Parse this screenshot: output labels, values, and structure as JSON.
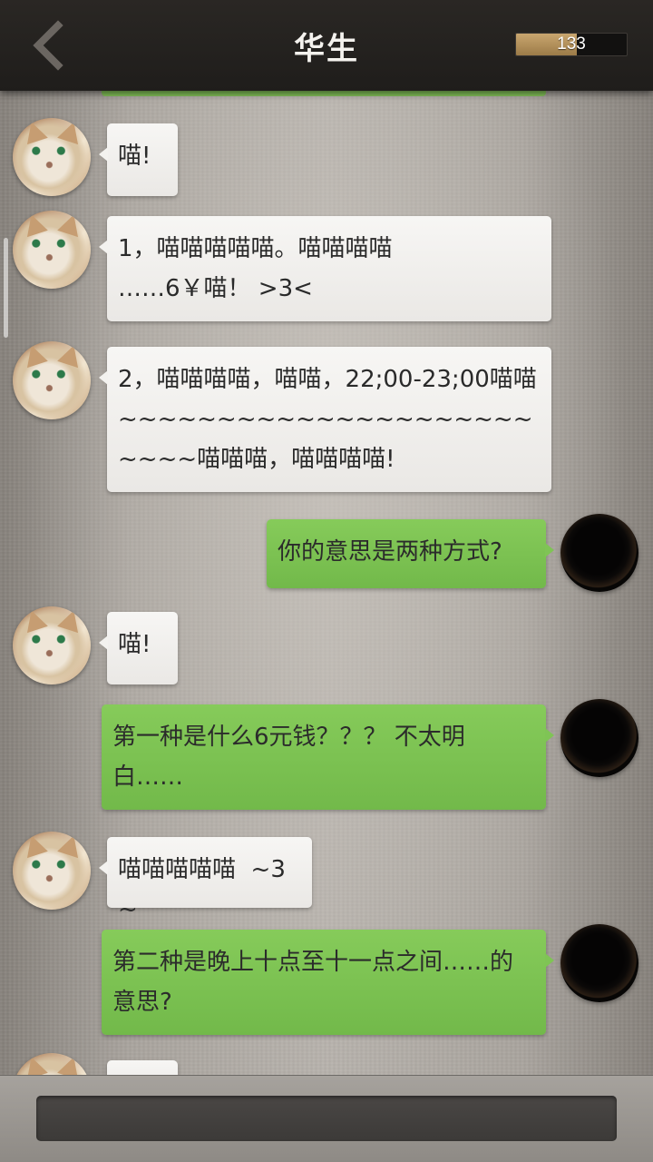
{
  "header": {
    "title": "华生",
    "back_icon": "chevron-left-icon",
    "counter_value": "133",
    "counter_fill_fraction": 0.55
  },
  "messages": [
    {
      "side": "in",
      "text": "喵!"
    },
    {
      "side": "in",
      "text": "1，喵喵喵喵喵。喵喵喵喵\n……6￥喵！ >3<"
    },
    {
      "side": "in",
      "text": "2，喵喵喵喵，喵喵，22;00-23;00喵喵~~~~~~~~~~~~~~~~~~~~~~~~~喵喵喵，喵喵喵喵!"
    },
    {
      "side": "out",
      "text": "你的意思是两种方式?"
    },
    {
      "side": "in",
      "text": "喵!"
    },
    {
      "side": "out",
      "text": "第一种是什么6元钱？？？ 不太明白……"
    },
    {
      "side": "in",
      "text": "喵喵喵喵喵  ~3~"
    },
    {
      "side": "out",
      "text": "第二种是晚上十点至十一点之间……的意思?"
    }
  ],
  "colors": {
    "header_bg": "#24211f",
    "bubble_out": "#7cc250",
    "bubble_in": "#f2f1ef",
    "counter_fill": "#b8955c"
  }
}
